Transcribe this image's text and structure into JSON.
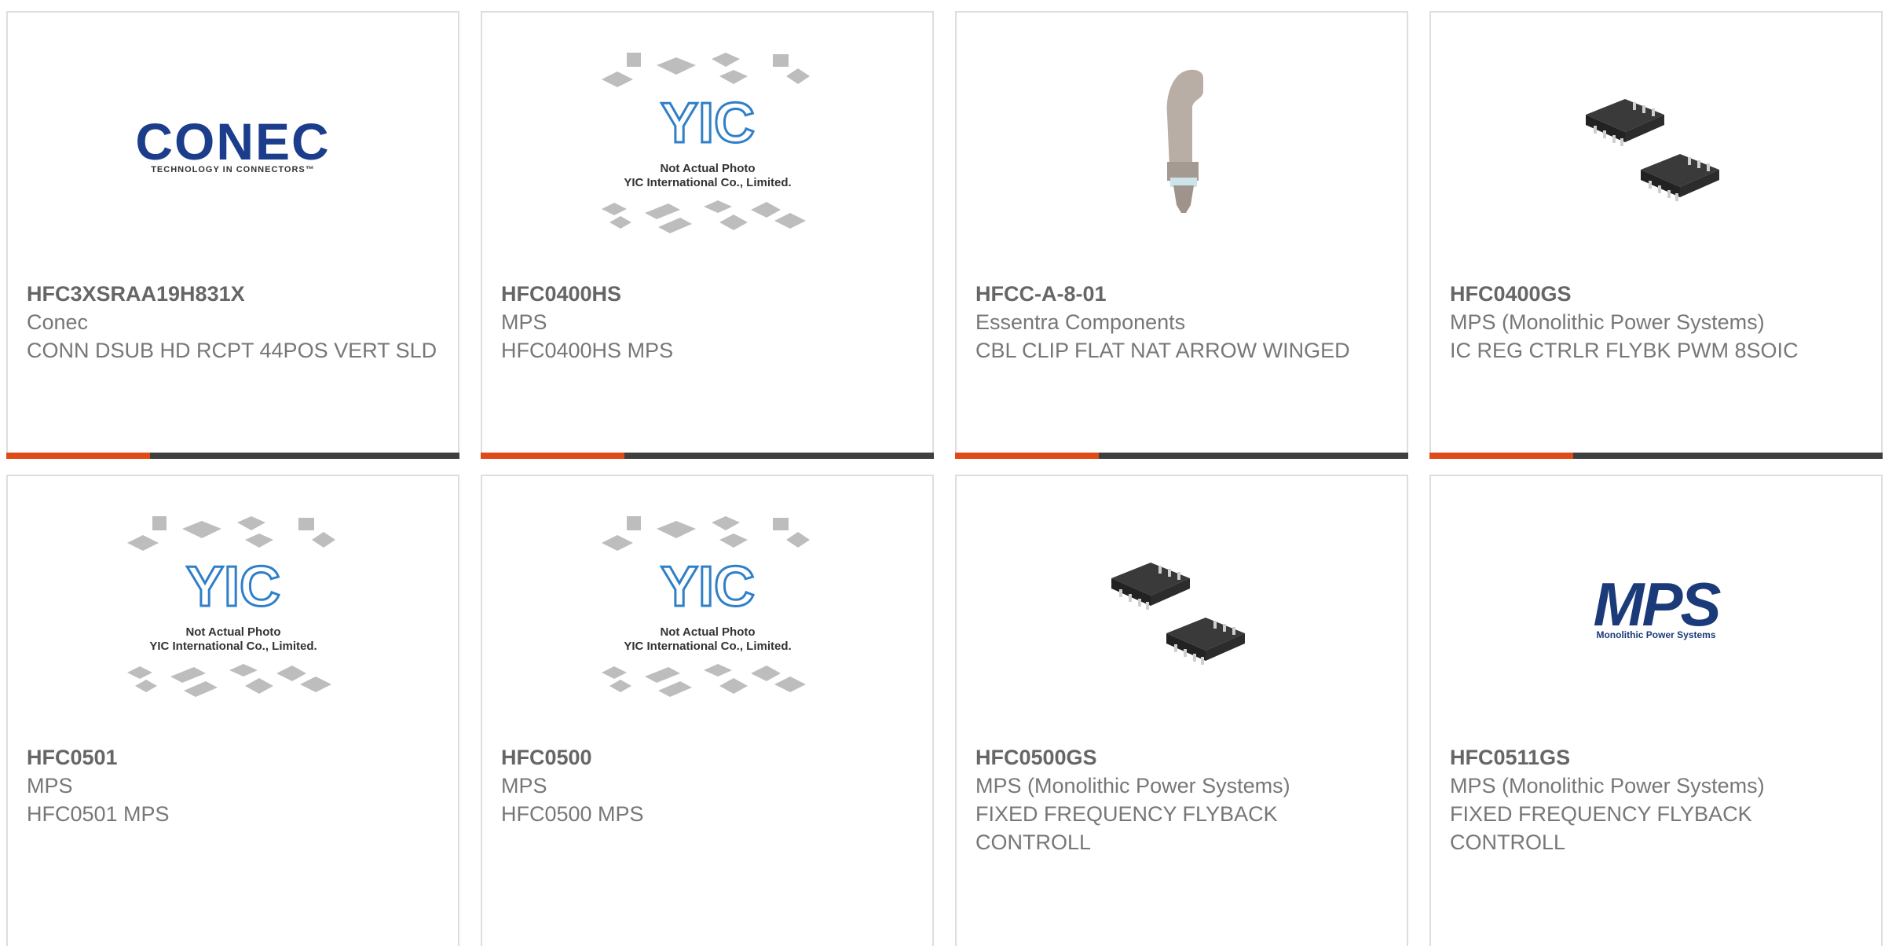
{
  "products": [
    {
      "part": "HFC3XSRAA19H831X",
      "mfr": "Conec",
      "desc": "CONN DSUB HD RCPT 44POS VERT SLD",
      "image": "conec-logo"
    },
    {
      "part": "HFC0400HS",
      "mfr": "MPS",
      "desc": "HFC0400HS MPS",
      "image": "yic-placeholder"
    },
    {
      "part": "HFCC-A-8-01",
      "mfr": "Essentra Components",
      "desc": "CBL CLIP FLAT NAT ARROW WINGED",
      "image": "cable-clip"
    },
    {
      "part": "HFC0400GS",
      "mfr": "MPS (Monolithic Power Systems)",
      "desc": "IC REG CTRLR FLYBK PWM 8SOIC",
      "image": "soic-chips"
    },
    {
      "part": "HFC0501",
      "mfr": "MPS",
      "desc": "HFC0501 MPS",
      "image": "yic-placeholder"
    },
    {
      "part": "HFC0500",
      "mfr": "MPS",
      "desc": "HFC0500 MPS",
      "image": "yic-placeholder"
    },
    {
      "part": "HFC0500GS",
      "mfr": "MPS (Monolithic Power Systems)",
      "desc": "FIXED FREQUENCY FLYBACK CONTROLL",
      "image": "soic-chips"
    },
    {
      "part": "HFC0511GS",
      "mfr": "MPS (Monolithic Power Systems)",
      "desc": "FIXED FREQUENCY FLYBACK CONTROLL",
      "image": "mps-logo"
    }
  ],
  "placeholder": {
    "line1": "Not Actual Photo",
    "line2": "YIC International Co., Limited.",
    "brand": "YIC"
  },
  "logos": {
    "conec": {
      "name": "CONEC",
      "tagline": "TECHNOLOGY IN CONNECTORS™"
    },
    "mps": {
      "name": "MPS",
      "tagline": "Monolithic Power Systems"
    }
  },
  "colors": {
    "accent": "#e04a16",
    "bar": "#3f3f3f",
    "border": "#dedede"
  }
}
